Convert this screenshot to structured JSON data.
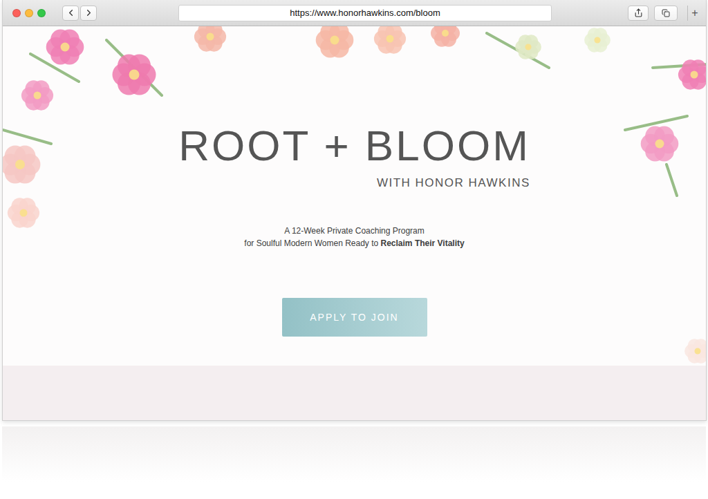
{
  "window": {
    "url": "https://www.honorhawkins.com/bloom",
    "new_tab": "+",
    "traffic_lights": [
      {
        "color": "#fc605b"
      },
      {
        "color": "#fdbc40"
      },
      {
        "color": "#34c84a"
      }
    ]
  },
  "hero": {
    "logo": "ROOT + BLOOM",
    "byline": "WITH HONOR HAWKINS",
    "tagline": "A 12-Week Private Coaching Program",
    "tagline_lead": "for Soulful Modern Women Ready to ",
    "tagline_strong": "Reclaim Their Vitality",
    "cta": "APPLY TO JOIN"
  }
}
